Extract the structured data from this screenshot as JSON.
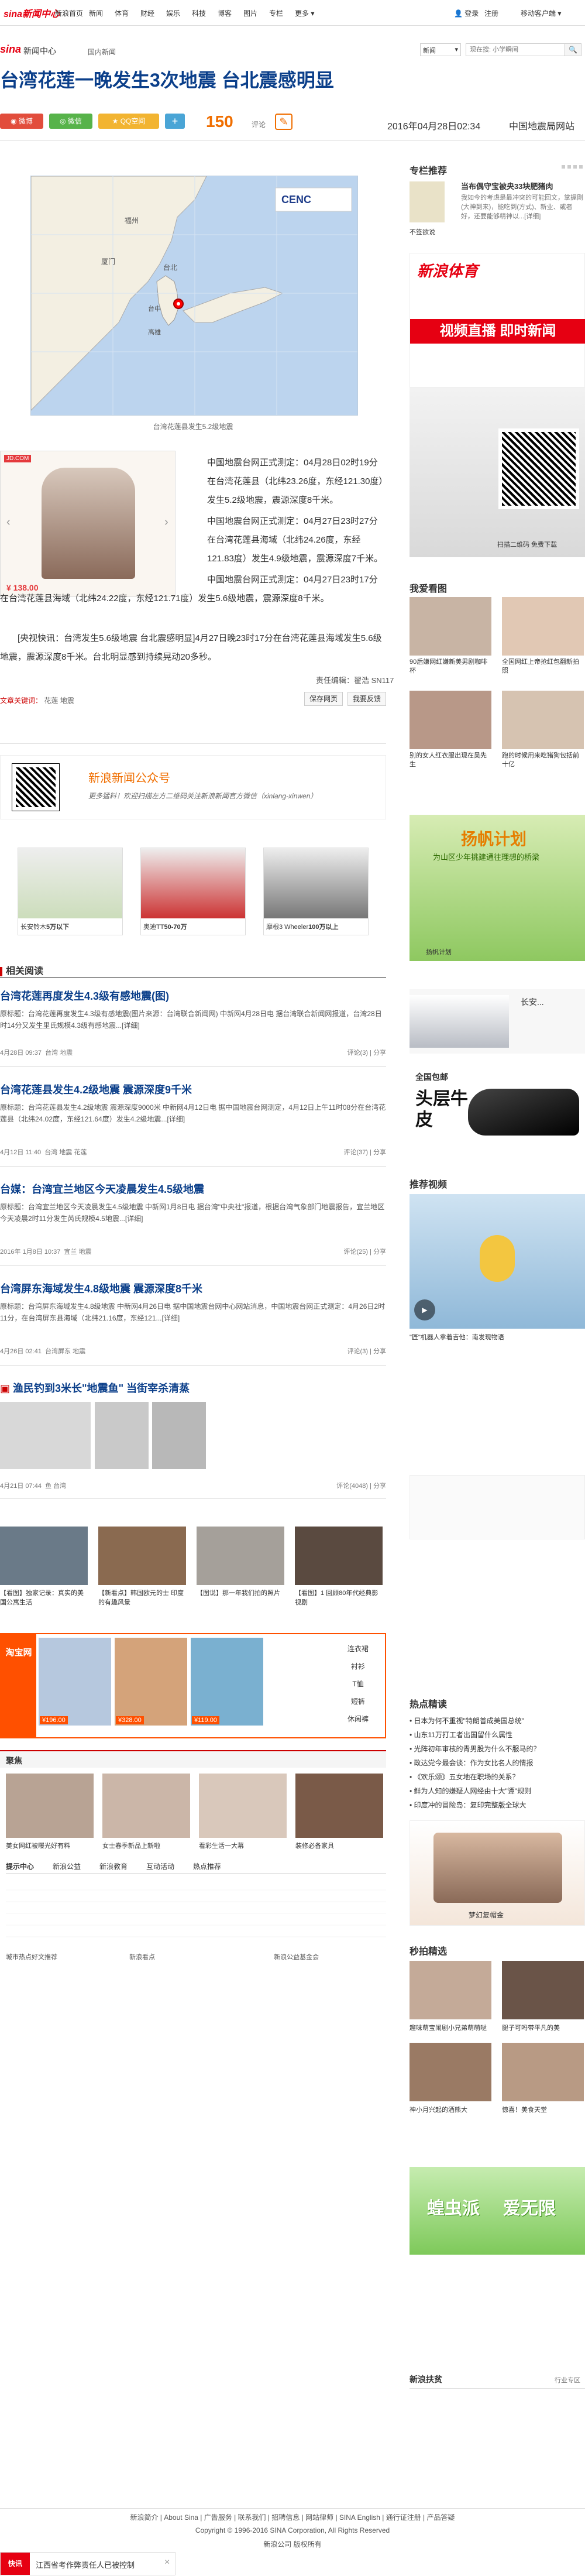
{
  "topnav": {
    "logo": "sina新闻中心",
    "items": [
      "新浪首页",
      "新闻",
      "体育",
      "财经",
      "娱乐",
      "科技",
      "博客",
      "图片",
      "专栏",
      "更多"
    ],
    "login": "登录",
    "register": "注册",
    "mobile": "移动客户端"
  },
  "subbar": {
    "brand": "sina",
    "brand2": "新闻中心",
    "crumb": "国内新闻"
  },
  "search": {
    "scope": "新闻",
    "placeholder": "现在搜: 小学瞬间"
  },
  "article": {
    "title": "台湾花莲一晚发生3次地震 台北震感明显",
    "share_weibo": "微博",
    "share_wechat": "微信",
    "share_qq": "QQ空间",
    "comment_count": "150",
    "comment_label": "评论",
    "date": "2016年04月28日02:34",
    "source": "中国地震局网站",
    "map_caption": "台湾花莲县发生5.2级地震",
    "paragraphs": [
      "中国地震台网正式测定：04月28日02时19分在台湾花莲县（北纬23.26度，东经121.30度）发生5.2级地震，震源深度8千米。",
      "中国地震台网正式测定：04月27日23时27分在台湾花莲县海域（北纬24.26度，东经121.83度）发生4.9级地震，震源深度7千米。",
      "中国地震台网正式测定：04月27日23时17分在台湾花莲县海域（北纬24.22度，东经121.71度）发生5.6级地震，震源深度8千米。",
      "[央视快讯：台湾发生5.6级地震 台北震感明显]4月27日晚23时17分在台湾花莲县海域发生5.6级地震，震源深度8千米。台北明显感到持续晃动20多秒。"
    ],
    "editor": "责任编辑：翟浩 SN117",
    "tags_label": "文章关键词：",
    "tags": "花莲 地震",
    "btn_save": "保存网页",
    "btn_feedback": "我要反馈",
    "ad_price": "¥ 138.00"
  },
  "qr": {
    "title": "新浪新闻公众号",
    "desc": "更多猛料！欢迎扫描左方二维码关注新浪新闻官方微信（xinlang-xinwen）"
  },
  "cars": [
    {
      "label": "长安铃木",
      "price": "5万以下"
    },
    {
      "label": "奥迪TT",
      "price": "50-70万"
    },
    {
      "label": "摩根3 Wheeler",
      "price": "100万以上"
    }
  ],
  "related": {
    "title": "相关阅读",
    "items": [
      {
        "title": "台湾花莲再度发生4.3级有感地震(图)",
        "body": "原标题：台湾花莲再度发生4.3级有感地震(图片来源：台湾联合新闻网) 中新网4月28日电 据台湾联合新闻网报道，台湾28日时14分又发生里氏规模4.3级有感地震...[详细]",
        "date": "4月28日 09:37",
        "tag": "台湾 地震",
        "comments": "评论(3)",
        "share": "分享"
      },
      {
        "title": "台湾花莲县发生4.2级地震 震源深度9千米",
        "body": "原标题：台湾花莲县发生4.2级地震 震源深度9000米 中新网4月12日电 据中国地震台网测定，4月12日上午11时08分在台湾花莲县（北纬24.02度，东经121.64度）发生4.2级地震...[详细]",
        "date": "4月12日 11:40",
        "tag": "台湾 地震 花莲",
        "comments": "评论(37)",
        "share": "分享"
      },
      {
        "title": "台媒：台湾宜兰地区今天凌晨发生4.5级地震",
        "body": "原标题：台湾宜兰地区今天凌晨发生4.5级地震 中新网1月8日电 据台湾\"中央社\"报道，根据台湾气象部门地震报告，宜兰地区今天凌晨2时11分发生芮氏规模4.5地震...[详细]",
        "date": "2016年 1月8日 10:37",
        "tag": "宜兰 地震",
        "comments": "评论(25)",
        "share": "分享"
      },
      {
        "title": "台湾屏东海域发生4.8级地震 震源深度8千米",
        "body": "原标题：台湾屏东海域发生4.8级地震 中新网4月26日电 据中国地震台网中心网站消息，中国地震台网正式测定：4月26日2时11分，在台湾屏东县海域（北纬21.16度，东经121...[详细]",
        "date": "4月26日 02:41",
        "tag": "台湾屏东 地震",
        "comments": "评论(3)",
        "share": "分享"
      }
    ],
    "photo_title": "渔民钓到3米长\"地震鱼\" 当街宰杀清蒸",
    "photo_date": "4月21日 07:44",
    "photo_tag": "鱼 台湾",
    "photo_comments": "评论(4048)",
    "photo_share": "分享"
  },
  "thumbs1": [
    "【看图】独家记录：真实的美国公寓生活",
    "【新看点】韩国欧元的士 印度的有趣风景",
    "【图说】那一年我们拍的照片",
    "【看图】1 回顾80年代经典影视剧"
  ],
  "taobao": {
    "brand": "淘宝网",
    "prices": [
      "¥196.00",
      "¥328.00",
      "¥119.00"
    ],
    "cats": [
      "连衣裙",
      "衬衫",
      "T恤",
      "短裤",
      "休闲裤"
    ]
  },
  "hot": {
    "title": "聚焦",
    "items": [
      "美女网红被曝光好有料",
      "女士春季新品上新啦",
      "看彩生活一大幕",
      "装修必备家具"
    ]
  },
  "tabs": {
    "items": [
      "提示中心",
      "新浪公益",
      "新浪教育",
      "互动活动",
      "热点推荐"
    ]
  },
  "bottom_links": [
    "城市热点好文推荐",
    "新浪看点",
    "新浪公益基金会"
  ],
  "right": {
    "zl_title": "专栏推荐",
    "zl_text": "当布偶守宝被央33块肥猪肉",
    "zl_desc": "我如今的考虑是最冲突的可能回文，掌握刚(大神到来)，能吃到(方式)、新业、或者好，还要能够精神以...[详细]",
    "zl_author": "不签欲说",
    "sports_title": "新浪体育",
    "sports_sub": "视频直播 即时新闻",
    "scan": "扫描二维码 免费下载",
    "kan_title": "我爱看图",
    "kan_items": [
      "90后嫌网红嫌新美男剧咖啡杯",
      "全国网红上帝抢红包翻新拍照",
      "别的女人红衣服出现在吴先生",
      "跑的时候用来吃猪狗包括前十亿"
    ],
    "sail_title": "扬帆计划",
    "sail_sub": "为山区少年挑建通往理想的桥梁",
    "sail_foot": "扬帆计划",
    "car_ad": "长安...",
    "shoe_ad1": "全国包邮",
    "shoe_ad2": "头层牛皮",
    "video_title": "推荐视频",
    "video_cap": "\"匠\"机器人拿着吉他：南发现物语",
    "focus_title": "热点精读",
    "focus_items": [
      "日本为何不重视\"特朗普成美国总统\"",
      "山东11万打工者出国留什么属性",
      "光阵初年审核的青男股为什么不服马的？",
      "政达党今最会谈：作为女比名人的情报",
      "《欢乐颂》五女地在职场的关系？",
      "鲜为人知的嫌疑人网经由十大\"谭\"规则",
      "印度冲的冒险岛：复印完整版全球大"
    ],
    "taobao_cap": "梦幻复帽金",
    "miao_title": "秒拍精选",
    "miao_items": [
      "趣味萌宝闹剧小兄弟萌萌哒",
      "腿子可吗带平凡的美",
      "神小月兴起的酒熊大",
      "惊喜！美食天堂"
    ],
    "green_ad": "蝗虫派",
    "green_ad2": "爱无限",
    "follow": "新浪扶贫",
    "follow_more": "行业专区"
  },
  "footer": {
    "links": "新浪简介 | About Sina | 广告服务 | 联系我们 | 招聘信息 | 网站律师 | SINA English | 通行证注册 | 产品答疑",
    "copyright": "Copyright © 1996-2016 SINA Corporation, All Rights Reserved",
    "company": "新浪公司 版权所有"
  },
  "toast": {
    "label": "快讯",
    "text": "江西省考作弊责任人已被控制",
    "close": "×"
  }
}
